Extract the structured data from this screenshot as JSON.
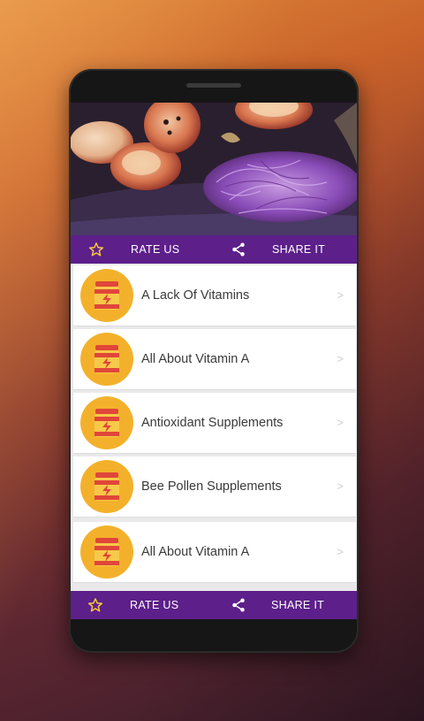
{
  "header_bar": {
    "rate_label": "RATE US",
    "share_label": "SHARE IT"
  },
  "list": {
    "items": [
      {
        "label": "A Lack Of Vitamins",
        "chevron": ">"
      },
      {
        "label": "All About Vitamin A",
        "chevron": ">"
      },
      {
        "label": "Antioxidant Supplements",
        "chevron": ">"
      },
      {
        "label": "Bee Pollen Supplements",
        "chevron": ">"
      },
      {
        "label": "All About Vitamin A",
        "chevron": ">"
      }
    ]
  },
  "footer_bar": {
    "rate_label": "RATE US",
    "share_label": "SHARE IT"
  },
  "colors": {
    "bar_purple": "#5d1f8a",
    "icon_orange": "#f3b12b",
    "jar_red": "#e0463a",
    "star_yellow": "#f5c93d"
  },
  "icons": {
    "rate": "star-outline-icon",
    "share": "share-icon",
    "item_thumb": "vitamin-jar-icon"
  }
}
